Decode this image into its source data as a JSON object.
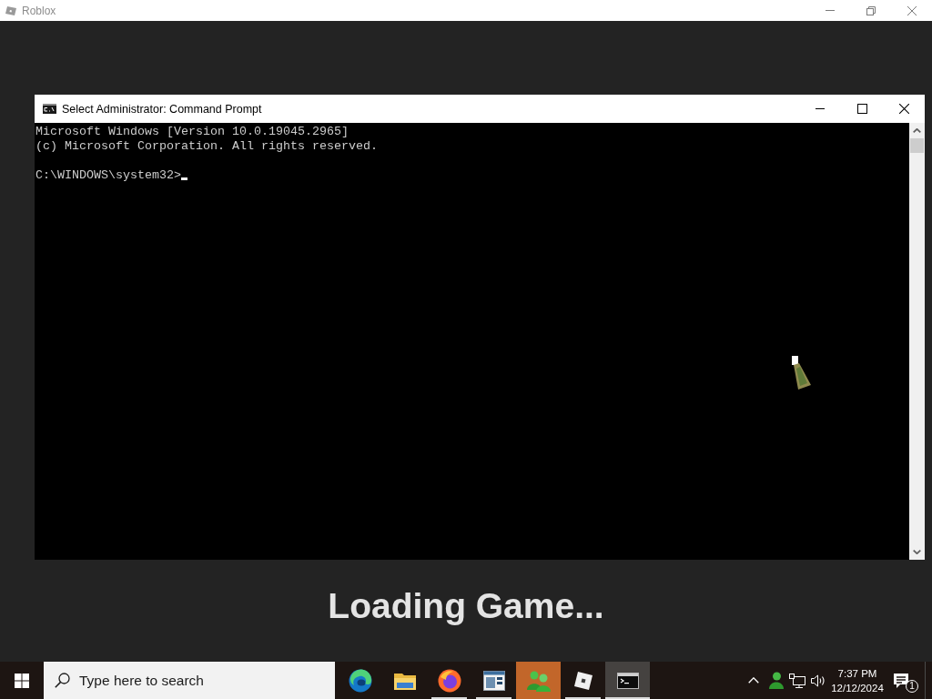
{
  "app_window": {
    "title": "Roblox"
  },
  "console_window": {
    "title": "Select Administrator: Command Prompt",
    "output_lines": [
      "Microsoft Windows [Version 10.0.19045.2965]",
      "(c) Microsoft Corporation. All rights reserved."
    ],
    "prompt": "C:\\WINDOWS\\system32>"
  },
  "loading_text": "Loading Game...",
  "taskbar": {
    "search": {
      "placeholder": "Type here to search"
    },
    "apps": [
      {
        "kind": "edge",
        "selected": false,
        "flashing": false,
        "running": false
      },
      {
        "kind": "folder",
        "selected": false,
        "flashing": false,
        "running": false
      },
      {
        "kind": "firefox",
        "selected": false,
        "flashing": false,
        "running": true
      },
      {
        "kind": "window",
        "selected": false,
        "flashing": false,
        "running": true
      },
      {
        "kind": "people",
        "selected": false,
        "flashing": true,
        "running": false
      },
      {
        "kind": "roblox",
        "selected": false,
        "flashing": false,
        "running": true
      },
      {
        "kind": "terminal",
        "selected": true,
        "flashing": false,
        "running": true
      }
    ],
    "tray": [
      {
        "kind": "chevron"
      },
      {
        "kind": "person"
      },
      {
        "kind": "network"
      },
      {
        "kind": "volume"
      }
    ],
    "clock": {
      "time": "7:37 PM",
      "date": "12/12/2024"
    },
    "notifications": {
      "count": "1"
    }
  }
}
